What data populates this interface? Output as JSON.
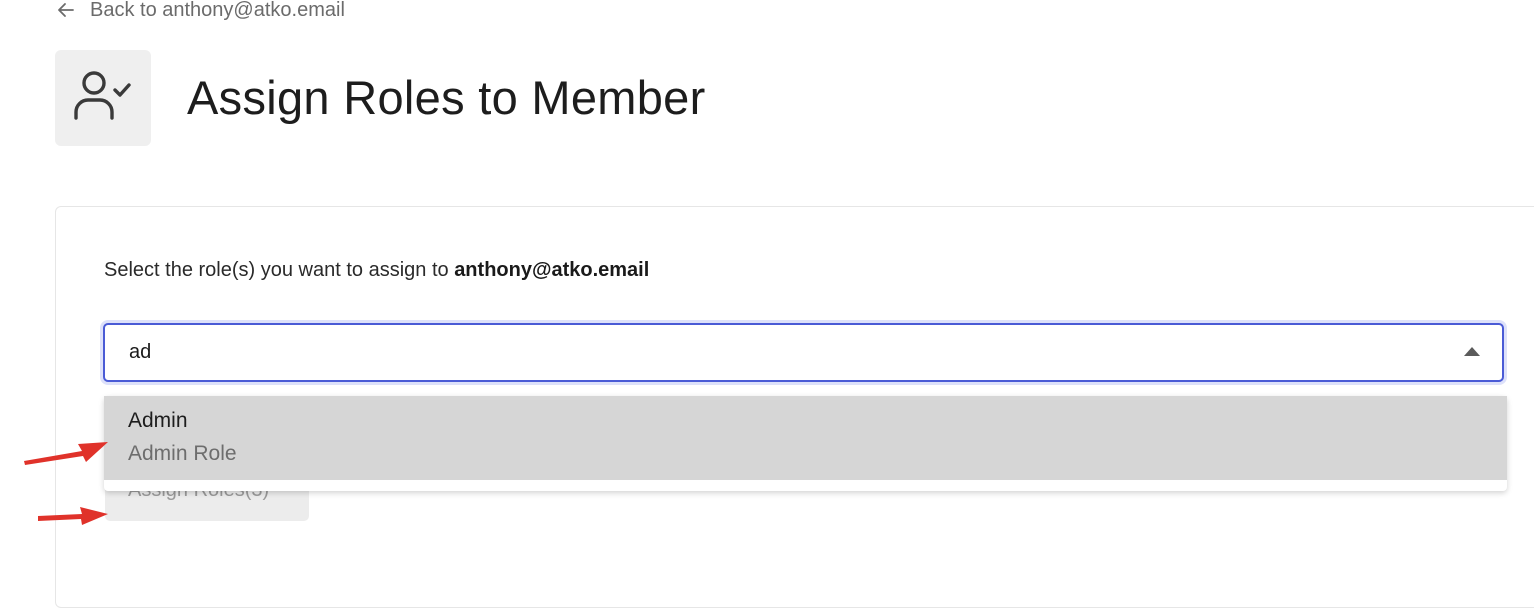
{
  "back_link": {
    "label": "Back to anthony@atko.email",
    "icon": "arrow-left-icon"
  },
  "header": {
    "icon": "user-check-icon",
    "title": "Assign Roles to Member"
  },
  "form": {
    "instruction_prefix": "Select the role(s) you want to assign to ",
    "instruction_email": "anthony@atko.email",
    "search_value": "ad",
    "caret_icon": "caret-up-icon",
    "options": [
      {
        "label": "Admin",
        "description": "Admin Role"
      }
    ],
    "submit_label": "Assign Roles(3)"
  },
  "annotations": {
    "arrow_color": "#e0322a"
  },
  "colors": {
    "focus_border": "#4a5bd6",
    "option_highlight": "#d6d6d6"
  }
}
